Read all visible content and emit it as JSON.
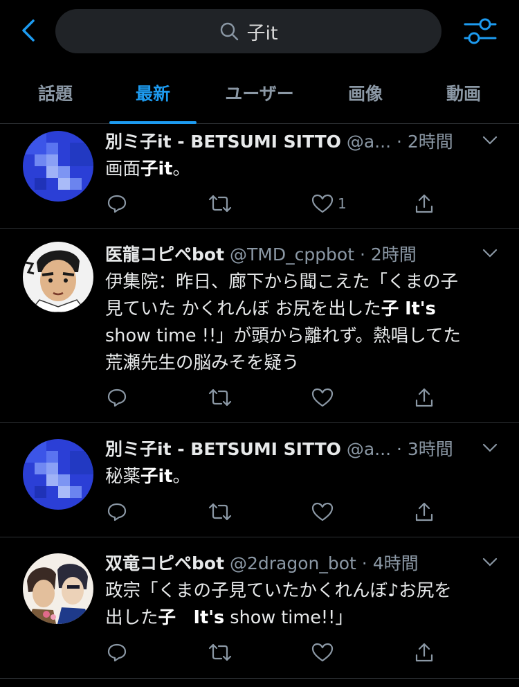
{
  "search": {
    "query": "子it"
  },
  "tabs": [
    {
      "label": "話題",
      "active": false
    },
    {
      "label": "最新",
      "active": true
    },
    {
      "label": "ユーザー",
      "active": false
    },
    {
      "label": "画像",
      "active": false
    },
    {
      "label": "動画",
      "active": false
    }
  ],
  "colors": {
    "accent": "#1d9bf0",
    "background": "#000000",
    "muted": "#8b98a5"
  },
  "tweets": [
    {
      "name": "別ミ子it - BETSUMI SITTO",
      "handle": "@a...",
      "time": "· 2時間",
      "text_parts": [
        "画面",
        "子it",
        "。"
      ],
      "like_count": "1"
    },
    {
      "name": "医龍コピペbot",
      "handle": "@TMD_cppbot",
      "time": "· 2時間",
      "text_parts": [
        "伊集院：昨日、廊下から聞こえた「くまの子\n見ていた かくれんぼ お尻を出した",
        "子 It's",
        "\nshow time !!」が頭から離れず。熱唱してた\n荒瀬先生の脳みそを疑う"
      ],
      "like_count": ""
    },
    {
      "name": "別ミ子it - BETSUMI SITTO",
      "handle": "@a...",
      "time": "· 3時間",
      "text_parts": [
        "秘薬",
        "子it",
        "。"
      ],
      "like_count": ""
    },
    {
      "name": "双竜コピペbot",
      "handle": "@2dragon_bot",
      "time": "· 4時間",
      "text_parts": [
        "政宗「くまの子見ていたかくれんぼ♪お尻を\n出した",
        "子　It's",
        " show time!!」"
      ],
      "like_count": ""
    }
  ],
  "icons": {
    "back": "chevron-left-icon",
    "search": "search-icon",
    "filter": "sliders-icon",
    "reply": "reply-icon",
    "retweet": "retweet-icon",
    "like": "heart-icon",
    "share": "share-icon",
    "more": "chevron-down-icon"
  }
}
